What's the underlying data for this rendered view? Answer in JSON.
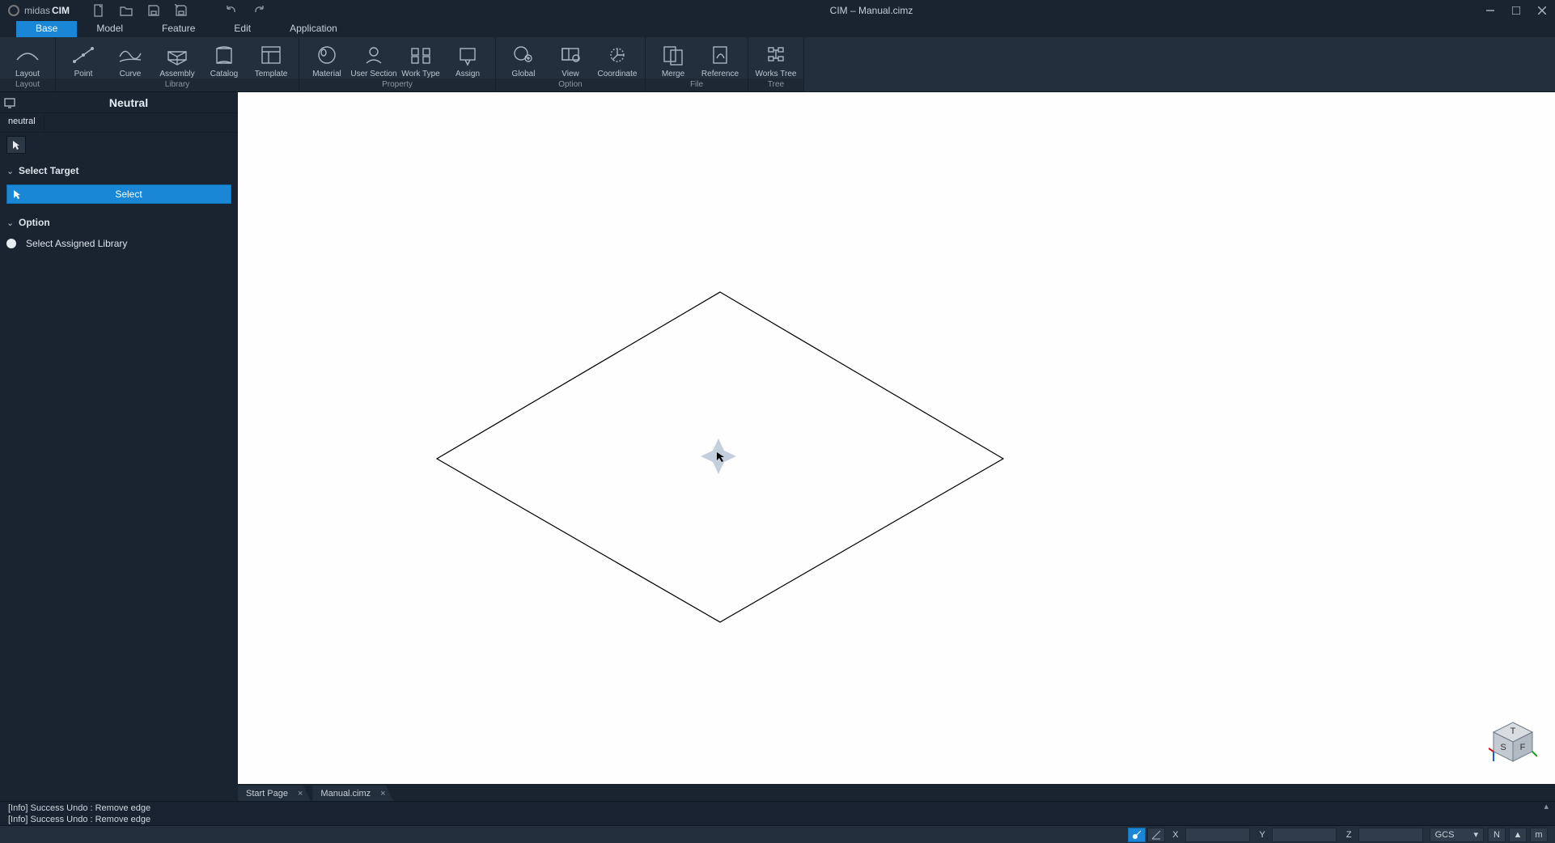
{
  "app": {
    "brand1": "midas",
    "brand2": " CIM",
    "title": "CIM – Manual.cimz"
  },
  "menu_tabs": [
    "Base",
    "Model",
    "Feature",
    "Edit",
    "Application"
  ],
  "ribbon": {
    "groups": [
      {
        "label": "Layout",
        "items": [
          "Layout"
        ]
      },
      {
        "label": "Library",
        "items": [
          "Point",
          "Curve",
          "Assembly",
          "Catalog",
          "Template"
        ]
      },
      {
        "label": "Property",
        "items": [
          "Material",
          "User Section",
          "Work Type",
          "Assign"
        ]
      },
      {
        "label": "Option",
        "items": [
          "Global",
          "View",
          "Coordinate"
        ]
      },
      {
        "label": "File",
        "items": [
          "Merge",
          "Reference"
        ]
      },
      {
        "label": "Tree",
        "items": [
          "Works Tree"
        ]
      }
    ]
  },
  "side_panel": {
    "title": "Neutral",
    "sub_tab": "neutral",
    "section1": "Select Target",
    "select_btn": "Select",
    "section2": "Option",
    "radio1": "Select Assigned Library"
  },
  "doc_tabs": [
    "Start Page",
    "Manual.cimz"
  ],
  "log": [
    "[Info] Success Undo : Remove edge",
    "[Info] Success Undo : Remove edge"
  ],
  "status": {
    "coord_labels": [
      "X",
      "Y",
      "Z"
    ],
    "gcs": "GCS",
    "right_btns": [
      "N",
      "▲",
      "m"
    ]
  },
  "icons": {
    "new": "new-file-icon",
    "open": "open-file-icon",
    "save": "save-icon",
    "saveas": "save-as-icon",
    "undo": "undo-icon",
    "redo": "redo-icon"
  }
}
